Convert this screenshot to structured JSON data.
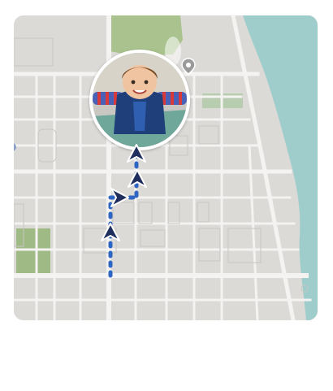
{
  "map": {
    "water_color": "#9ecdcb",
    "land_color": "#dcdad7",
    "street_color": "#f4f3f1",
    "block_outline_color": "#c8c6c2",
    "park_color": "#9fba84",
    "route_color": "#2f66c4",
    "arrow_color": "#1f2e5c",
    "arrow_outline_color": "#ffffff"
  },
  "avatar": {
    "subject": "child-lying-on-slide-photo",
    "ring_color": "#ffffff"
  },
  "icons": {
    "pin": "map-pin-icon",
    "arrows": [
      "direction-arrow-icon",
      "direction-arrow-icon",
      "direction-arrow-icon",
      "direction-arrow-icon"
    ]
  }
}
